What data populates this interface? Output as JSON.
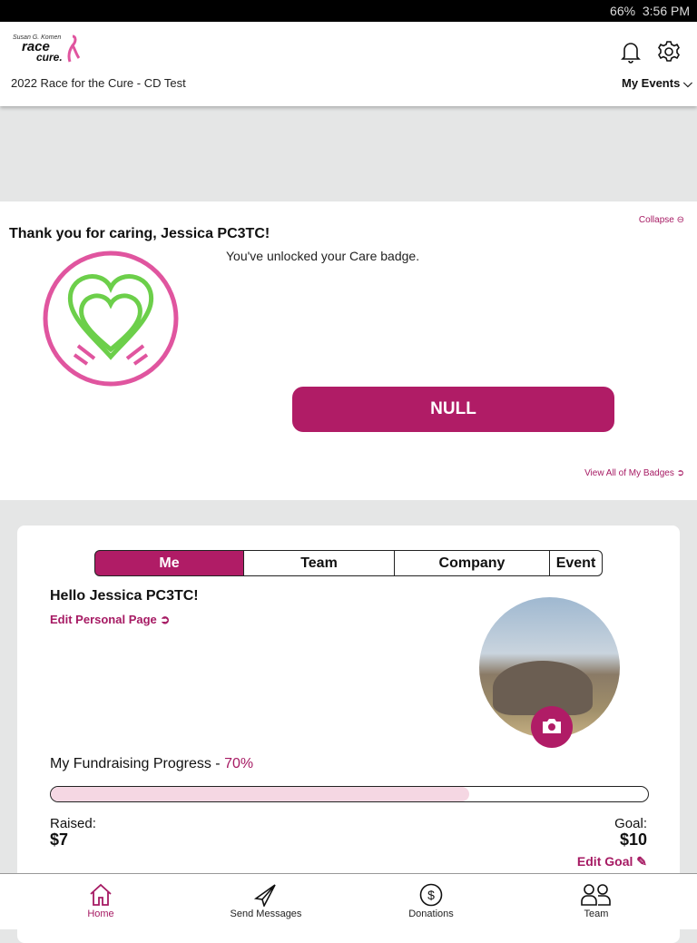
{
  "status_bar": {
    "battery": "66%",
    "time": "3:56 PM"
  },
  "header": {
    "logo_text": "Susan G. Komen race for the cure",
    "event_title": "2022 Race for the Cure - CD Test",
    "my_events_label": "My Events"
  },
  "badge_panel": {
    "collapse_label": "Collapse",
    "title": "Thank you for caring, Jessica PC3TC!",
    "message": "You've unlocked your Care badge.",
    "action_label": "NULL",
    "view_all_label": "View All of My Badges"
  },
  "card": {
    "tabs": [
      {
        "label": "Me",
        "active": true
      },
      {
        "label": "Team"
      },
      {
        "label": "Company"
      },
      {
        "label": "Event"
      }
    ],
    "greeting": "Hello Jessica PC3TC!",
    "edit_page_label": "Edit Personal Page",
    "progress_label": "My Fundraising Progress - ",
    "progress_percent_text": "70%",
    "progress_fraction": 0.7,
    "raised_label": "Raised:",
    "raised_value": "$7",
    "goal_label": "Goal:",
    "goal_value": "$10",
    "edit_goal_label": "Edit Goal"
  },
  "nav": {
    "items": [
      {
        "label": "Home",
        "icon": "home-icon",
        "active": true
      },
      {
        "label": "Send Messages",
        "icon": "paper-plane-icon"
      },
      {
        "label": "Donations",
        "icon": "dollar-circle-icon"
      },
      {
        "label": "Team",
        "icon": "people-icon"
      }
    ]
  },
  "colors": {
    "accent": "#a61a63",
    "button": "#b01c66",
    "progress_fill": "#f5d7e3",
    "badge_ring": "#e0559f",
    "badge_heart": "#6ccf4a"
  }
}
